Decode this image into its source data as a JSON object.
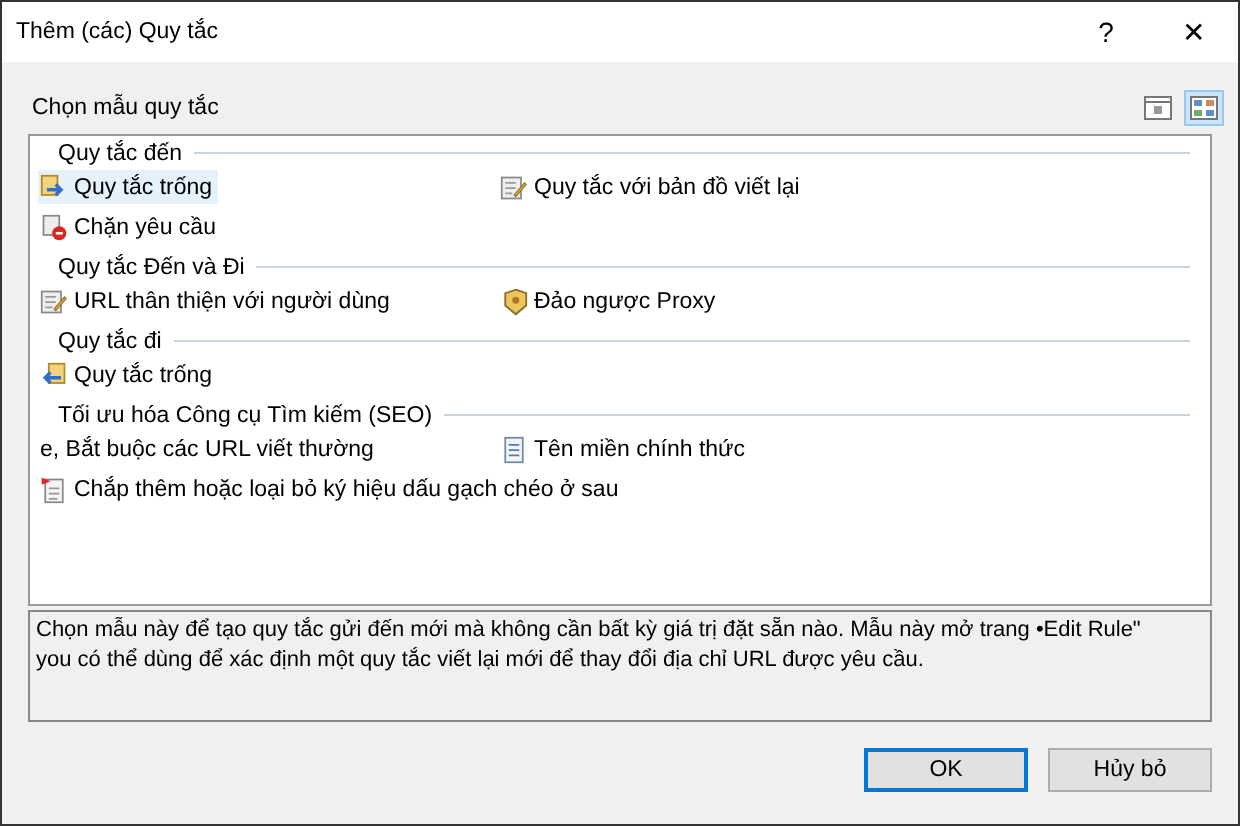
{
  "window": {
    "title": "Thêm (các) Quy tắc",
    "help": "?",
    "close": "✕"
  },
  "section_label": "Chọn mẫu quy tắc",
  "view_buttons": [
    {
      "kind": "details",
      "selected": false
    },
    {
      "kind": "tiles",
      "selected": true
    }
  ],
  "groups": [
    {
      "title": "Quy tắc đến",
      "items": [
        {
          "label": "Quy tắc trống",
          "kind": "in",
          "selected": true
        },
        {
          "label": "Quy tắc với bản đồ viết lại",
          "kind": "edit",
          "selected": false
        },
        {
          "label": "Chặn yêu cầu",
          "kind": "block",
          "selected": false
        }
      ]
    },
    {
      "title": "Quy tắc Đến và Đi",
      "items": [
        {
          "label": "URL thân thiện với người dùng",
          "kind": "edit",
          "selected": false
        },
        {
          "label": "Đảo ngược Proxy",
          "kind": "proxy",
          "selected": false
        }
      ]
    },
    {
      "title": "Quy tắc đi",
      "items": [
        {
          "label": "Quy tắc trống",
          "kind": "out",
          "selected": false
        }
      ]
    },
    {
      "title": "Tối ưu hóa Công cụ Tìm kiếm (SEO)",
      "items": [
        {
          "label": "e, Bắt buộc các URL viết thường",
          "kind": "plain",
          "selected": false
        },
        {
          "label": "Tên miền chính thức",
          "kind": "doc",
          "selected": false
        },
        {
          "label": "Chắp thêm hoặc loại bỏ ký hiệu dấu gạch chéo ở sau",
          "kind": "flagdoc",
          "selected": false
        }
      ]
    }
  ],
  "description": "Chọn mẫu này để tạo quy tắc gửi đến mới mà không cần bất kỳ giá trị đặt sẵn nào. Mẫu này mở trang •Edit Rule\"\nyou có thể dùng để xác định một quy tắc viết lại mới để thay đổi địa chỉ URL được yêu cầu.",
  "buttons": [
    {
      "label": "OK",
      "default": true
    },
    {
      "label": "Hủy bỏ",
      "default": false
    }
  ]
}
